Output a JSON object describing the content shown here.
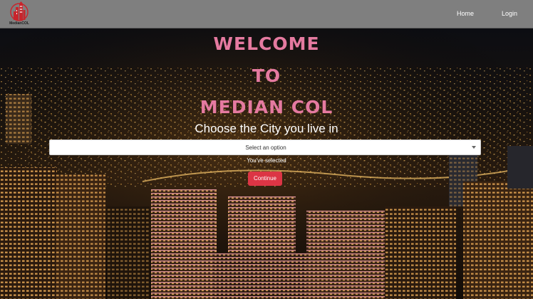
{
  "header": {
    "logo_text": "MedianCOL",
    "nav": [
      {
        "label": "Home"
      },
      {
        "label": "Login"
      }
    ]
  },
  "hero": {
    "welcome_lines": [
      "WELCOME",
      "TO",
      "MEDIAN COL"
    ],
    "subtitle": "Choose the City you live in",
    "select": {
      "value": "Select an option"
    },
    "selected_note": "You've selected",
    "continue_label": "Continue"
  },
  "colors": {
    "navbar": "#7f7f7f",
    "heading": "#e57aa0",
    "button": "#dc3545",
    "logo": "#c8252c"
  },
  "icons": [
    "building-logo-icon",
    "chevron-down-icon"
  ]
}
